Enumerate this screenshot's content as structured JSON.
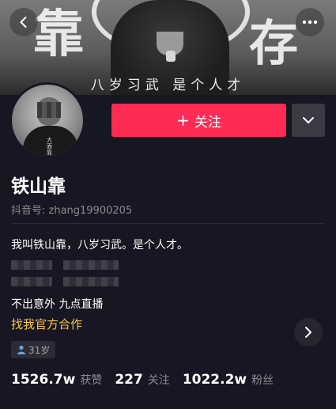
{
  "banner": {
    "left_char": "靠",
    "right_char": "存",
    "slogan": "八岁习武 是个人才"
  },
  "avatar": {
    "shirt_text": "大面靠"
  },
  "follow": {
    "icon": "+",
    "label": "关注"
  },
  "profile": {
    "name": "铁山靠",
    "douyin_id": "抖音号: zhang19900205",
    "bio_line1": "我叫铁山靠，八岁习武。是个人才。",
    "bio_line2": "不出意外 九点直播",
    "collab_link": "找我官方合作",
    "age": "31岁"
  },
  "stats": [
    {
      "value": "1526.7w",
      "label": "获赞"
    },
    {
      "value": "227",
      "label": "关注"
    },
    {
      "value": "1022.2w",
      "label": "粉丝"
    }
  ],
  "colors": {
    "background": "#161722",
    "follow_button": "#fe2c55",
    "collab_link": "#f7c34a"
  },
  "icons": [
    "back-icon",
    "more-icon",
    "plus-icon",
    "chevron-down-icon",
    "chevron-right-icon",
    "user-icon"
  ]
}
